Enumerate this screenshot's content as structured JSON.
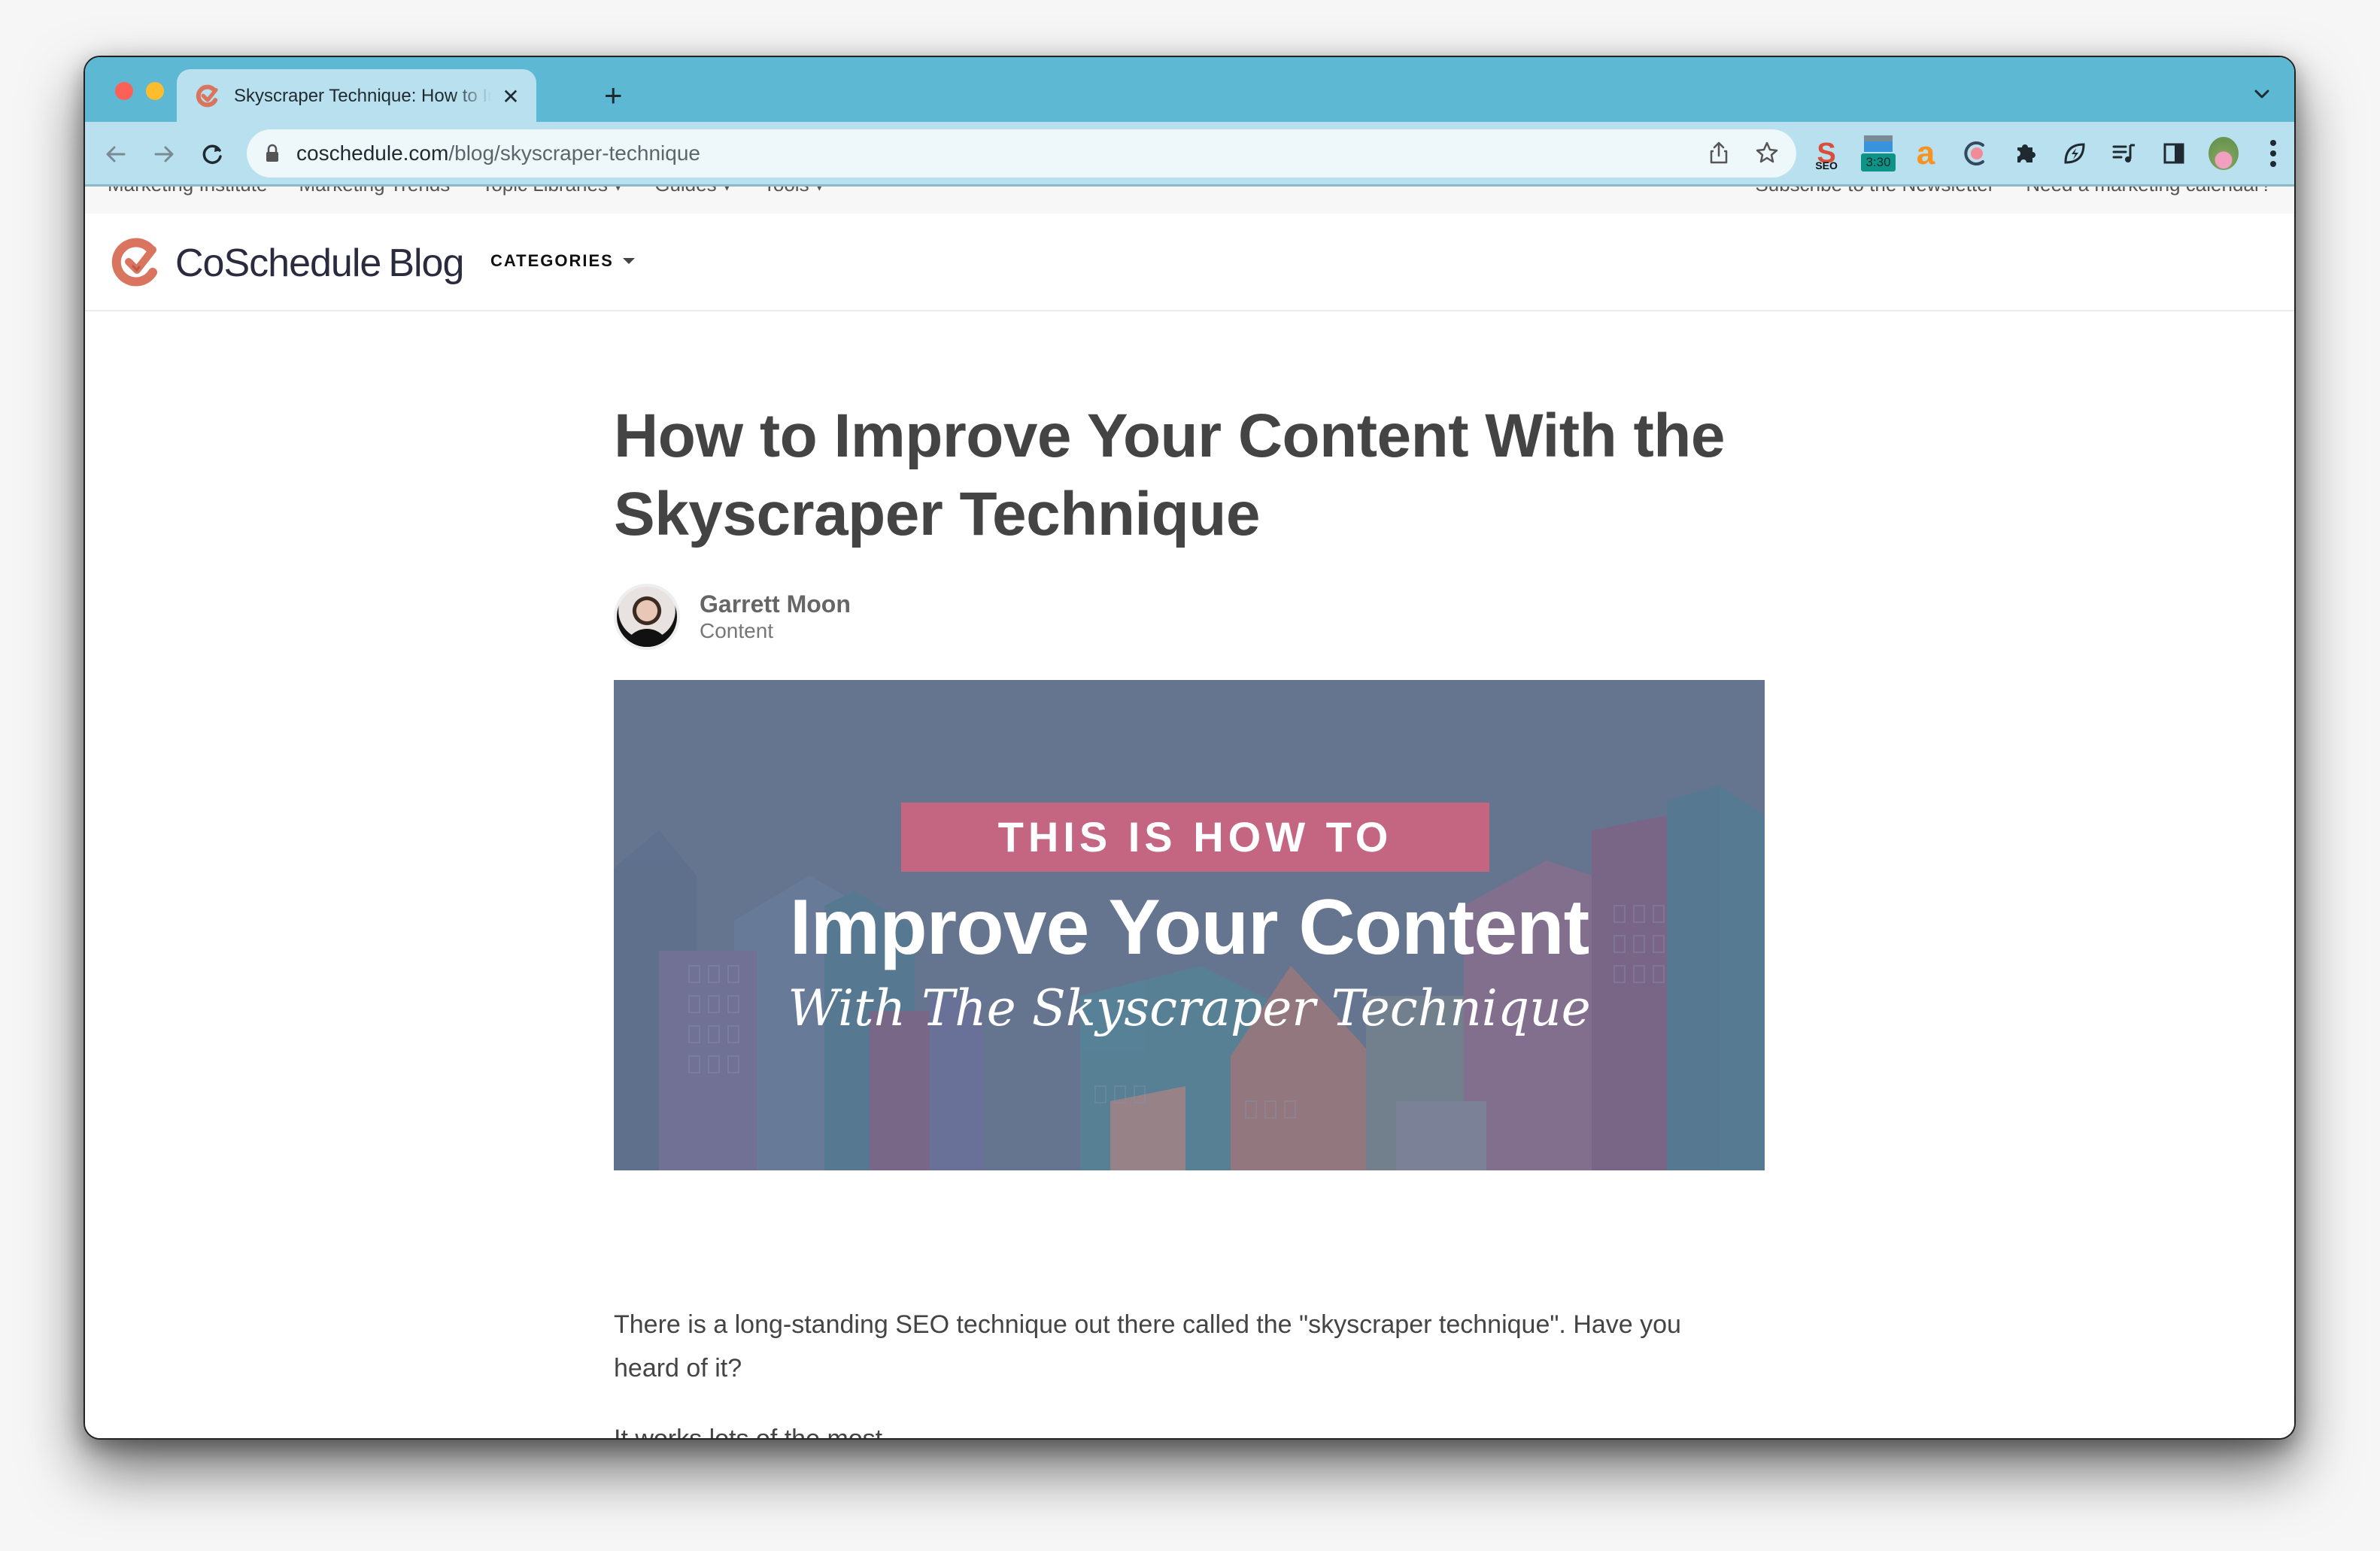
{
  "browser": {
    "tab": {
      "title": "Skyscraper Technique: How to Improve Your Content",
      "favicon": "coschedule-check-icon"
    },
    "new_tab_label": "+",
    "close_tab_label": "✕",
    "url": {
      "domain": "coschedule.com",
      "path": "/blog/skyscraper-technique"
    },
    "extensions": [
      {
        "name": "seo-extension-icon",
        "label": "S",
        "sub": "SEO"
      },
      {
        "name": "timer-extension-icon",
        "label": "3:30"
      },
      {
        "name": "amazon-assistant-icon",
        "label": "a"
      },
      {
        "name": "coschedule-extension-icon"
      },
      {
        "name": "extensions-puzzle-icon"
      },
      {
        "name": "leaf-bolt-extension-icon"
      },
      {
        "name": "reading-list-icon"
      },
      {
        "name": "side-panel-icon"
      },
      {
        "name": "profile-avatar"
      },
      {
        "name": "menu-kebab-icon"
      }
    ]
  },
  "site": {
    "topnav_left": [
      "Marketing Institute",
      "Marketing Trends",
      "Topic Libraries ▾",
      "Guides ▾",
      "Tools ▾"
    ],
    "topnav_right": [
      "Subscribe to the Newsletter",
      "Need a marketing calendar?"
    ],
    "logo_name": "CoSchedule",
    "logo_suffix": "Blog",
    "categories_label": "CATEGORIES",
    "brand_color": "#d9745e"
  },
  "article": {
    "title": "How to Improve Your Content With the Skyscraper Technique",
    "author_name": "Garrett Moon",
    "author_category": "Content",
    "hero": {
      "badge": "THIS IS HOW TO",
      "headline": "Improve Your Content",
      "subheadline": "With The Skyscraper Technique",
      "badge_color": "#c46682",
      "background_color": "#657590"
    },
    "paragraphs": [
      "There is a long-standing SEO technique out there called the \"skyscraper technique\". Have you heard of it?",
      "It works lots of the most..."
    ]
  }
}
